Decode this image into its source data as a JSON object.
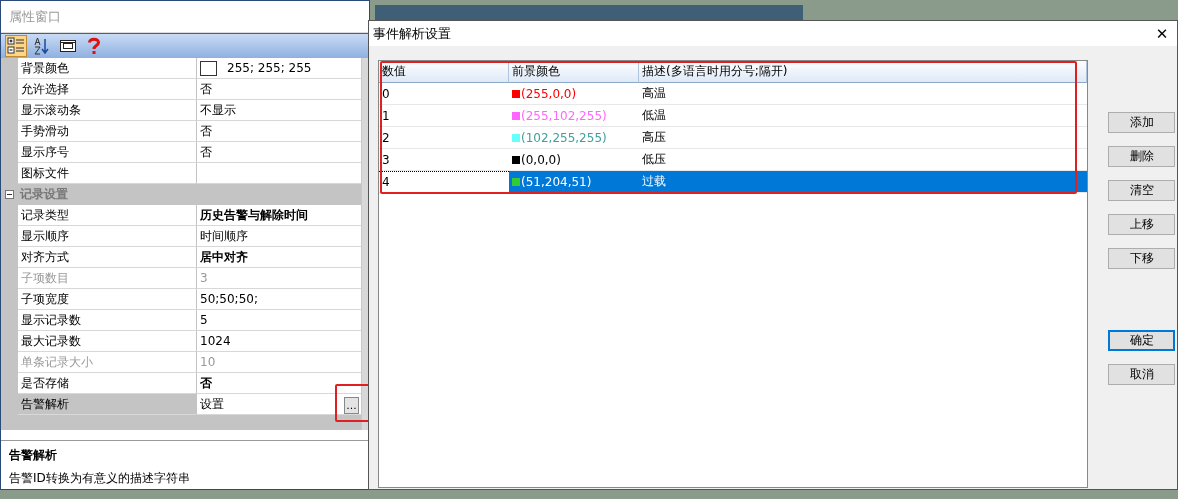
{
  "property_window": {
    "title": "属性窗口",
    "toolbar": [
      {
        "kind": "categorized",
        "selected": true
      },
      {
        "kind": "alphabetical",
        "selected": false
      },
      {
        "kind": "pages",
        "selected": false
      },
      {
        "kind": "help",
        "selected": false
      }
    ],
    "rows": [
      {
        "kind": "color",
        "name": "背景颜色",
        "value": "255; 255; 255",
        "color": "#ffffff",
        "disabled": false,
        "bold": false
      },
      {
        "kind": "property",
        "name": "允许选择",
        "value": "否",
        "disabled": false,
        "bold": false
      },
      {
        "kind": "property",
        "name": "显示滚动条",
        "value": "不显示",
        "disabled": false,
        "bold": false
      },
      {
        "kind": "property",
        "name": "手势滑动",
        "value": "否",
        "disabled": false,
        "bold": false
      },
      {
        "kind": "property",
        "name": "显示序号",
        "value": "否",
        "disabled": false,
        "bold": false
      },
      {
        "kind": "property",
        "name": "图标文件",
        "disabled": false
      },
      {
        "kind": "category",
        "name": "记录设置",
        "expanded": true
      },
      {
        "kind": "property",
        "name": "记录类型",
        "value": "历史告警与解除时间",
        "disabled": false,
        "bold": true
      },
      {
        "kind": "property",
        "name": "显示顺序",
        "value": "时间顺序",
        "disabled": false,
        "bold": false
      },
      {
        "kind": "property",
        "name": "对齐方式",
        "value": "居中对齐",
        "disabled": false,
        "bold": true
      },
      {
        "kind": "property",
        "name": "子项数目",
        "value": "3",
        "disabled": true,
        "bold": false
      },
      {
        "kind": "property",
        "name": "子项宽度",
        "value": "50;50;50;",
        "disabled": false,
        "bold": false
      },
      {
        "kind": "property",
        "name": "显示记录数",
        "value": "5",
        "disabled": false,
        "bold": false
      },
      {
        "kind": "property",
        "name": "最大记录数",
        "value": "1024",
        "disabled": false,
        "bold": false
      },
      {
        "kind": "property",
        "name": "单条记录大小",
        "value": "10",
        "disabled": true,
        "bold": false
      },
      {
        "kind": "property",
        "name": "是否存储",
        "value": "否",
        "disabled": false,
        "bold": true
      },
      {
        "kind": "button",
        "name": "告警解析",
        "value": "设置",
        "button": "...",
        "selected": true,
        "highlighted": true,
        "disabled": false,
        "bold": false
      }
    ],
    "description": {
      "title": "告警解析",
      "text": "告警ID转换为有意义的描述字符串"
    }
  },
  "dialog": {
    "title": "事件解析设置",
    "close": "✕",
    "highlighted": true,
    "columns": [
      "数值",
      "前景颜色",
      "描述(多语言时用分号;隔开)"
    ],
    "rows": [
      {
        "value": "0",
        "color": "#ff0000",
        "color_text": "(255,0,0)",
        "description": "高温",
        "selected": false
      },
      {
        "value": "1",
        "color": "#ff66ff",
        "color_text": "(255,102,255)",
        "description": "低温",
        "selected": false
      },
      {
        "value": "2",
        "color": "#66ffff",
        "color_text": "(102,255,255)",
        "description": "高压",
        "selected": false
      },
      {
        "value": "3",
        "color": "#000000",
        "color_text": "(0,0,0)",
        "description": "低压",
        "selected": false
      },
      {
        "value": "4",
        "color": "#33cc33",
        "color_text": "(51,204,51)",
        "description": "过载",
        "selected": true
      }
    ],
    "buttons": [
      {
        "label": "添加",
        "default": false
      },
      {
        "label": "删除",
        "default": false
      },
      {
        "label": "清空",
        "default": false
      },
      {
        "label": "上移",
        "default": false
      },
      {
        "label": "下移",
        "default": false
      },
      {
        "label": "确定",
        "default": true
      },
      {
        "label": "取消",
        "default": false
      }
    ]
  }
}
